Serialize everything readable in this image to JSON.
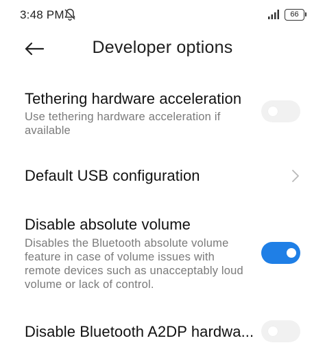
{
  "status_bar": {
    "time": "3:48 PM",
    "battery": "66",
    "icons": [
      "bell-off-icon",
      "signal-icon",
      "battery-icon"
    ]
  },
  "header": {
    "title": "Developer options",
    "back_icon": "arrow-left-icon"
  },
  "settings": [
    {
      "title": "Tethering hardware acceleration",
      "description_lines": [
        "Use tethering hardware acceleration if",
        "available"
      ],
      "control": "toggle",
      "enabled": false
    },
    {
      "title": "Default USB configuration",
      "control": "chevron",
      "icon": "chevron-right-icon"
    },
    {
      "title": "Disable absolute volume",
      "description_lines": [
        "Disables the Bluetooth absolute volume",
        "feature in case of volume issues with",
        "remote devices such as unacceptably loud",
        "volume or lack of control."
      ],
      "control": "toggle",
      "enabled": true
    },
    {
      "title": "Disable Bluetooth A2DP hardwa...",
      "control": "toggle",
      "enabled": false
    }
  ],
  "colors": {
    "accent": "#1f7fe6",
    "toggle_off": "#f1f1f1",
    "title_text": "#111111",
    "secondary_text": "#7a7a7a"
  }
}
